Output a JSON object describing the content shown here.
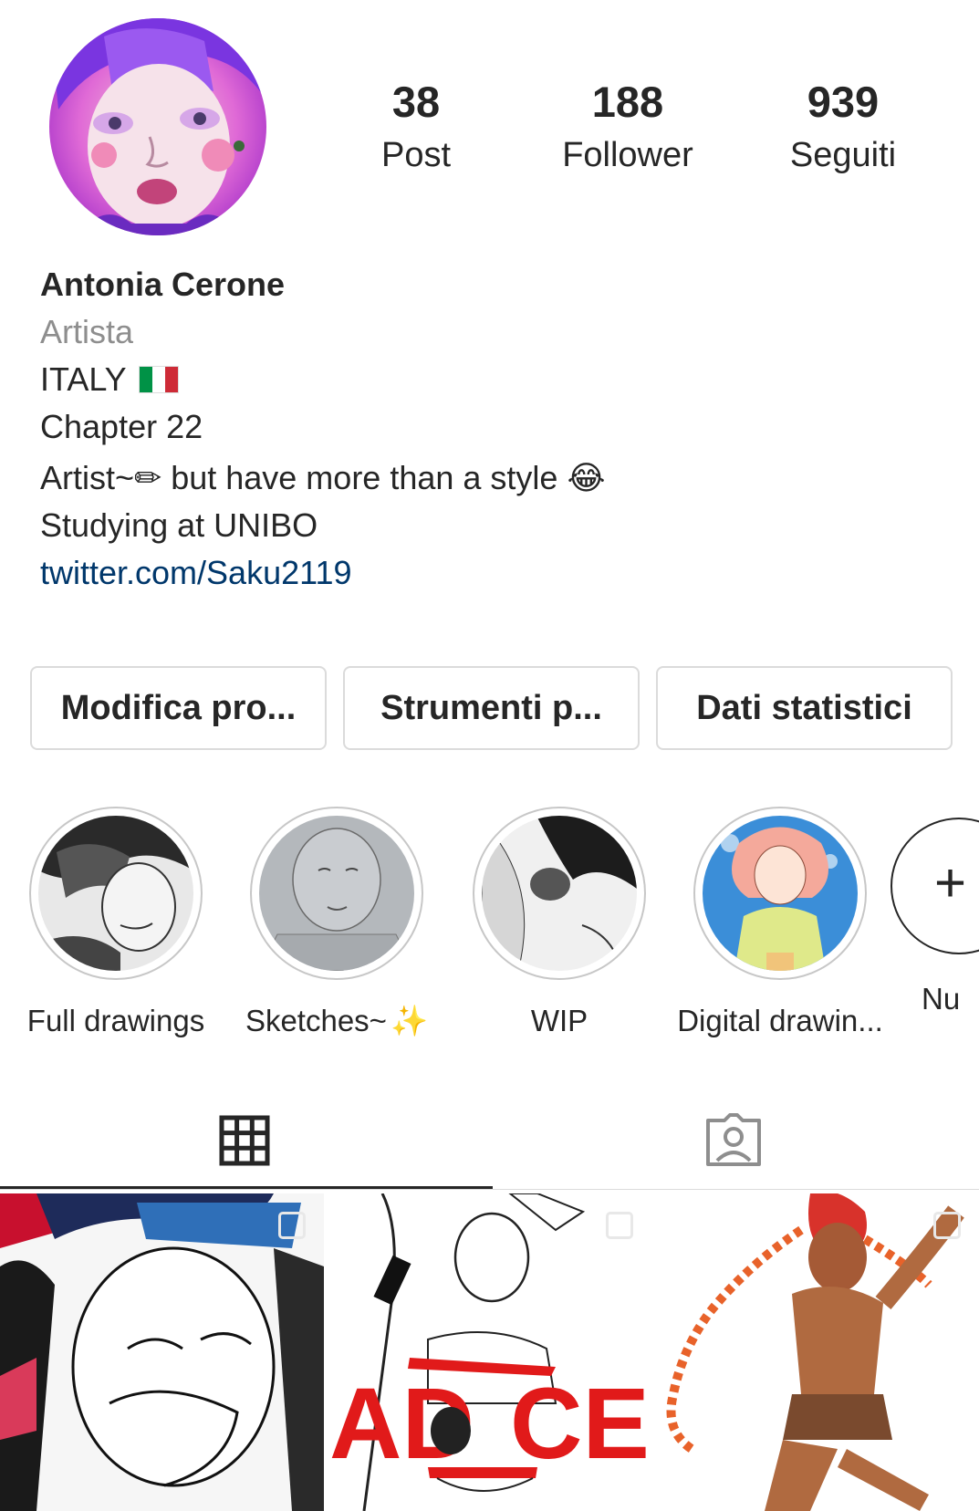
{
  "profile": {
    "stats": {
      "posts_count": "38",
      "posts_label": "Post",
      "followers_count": "188",
      "followers_label": "Follower",
      "following_count": "939",
      "following_label": "Seguiti"
    },
    "name": "Antonia Cerone",
    "category": "Artista",
    "bio_lines": {
      "line1": "ITALY",
      "line2": "Chapter 22",
      "line3": "Artist~✏ but have more than a style 😂",
      "line4": "Studying at UNIBO"
    },
    "link": "twitter.com/Saku2119"
  },
  "buttons": {
    "edit_profile": "Modifica pro...",
    "tools": "Strumenti p...",
    "insights": "Dati statistici"
  },
  "highlights": [
    {
      "label": "Full drawings"
    },
    {
      "label": "Sketches~"
    },
    {
      "label": "WIP"
    },
    {
      "label": "Digital drawin..."
    },
    {
      "label": "Nu"
    }
  ],
  "tabs": {
    "grid_icon": "grid-icon",
    "tagged_icon": "tagged-person-icon"
  },
  "colors": {
    "link": "#00376b",
    "secondary_text": "#8e8e8e",
    "border": "#dbdbdb"
  }
}
